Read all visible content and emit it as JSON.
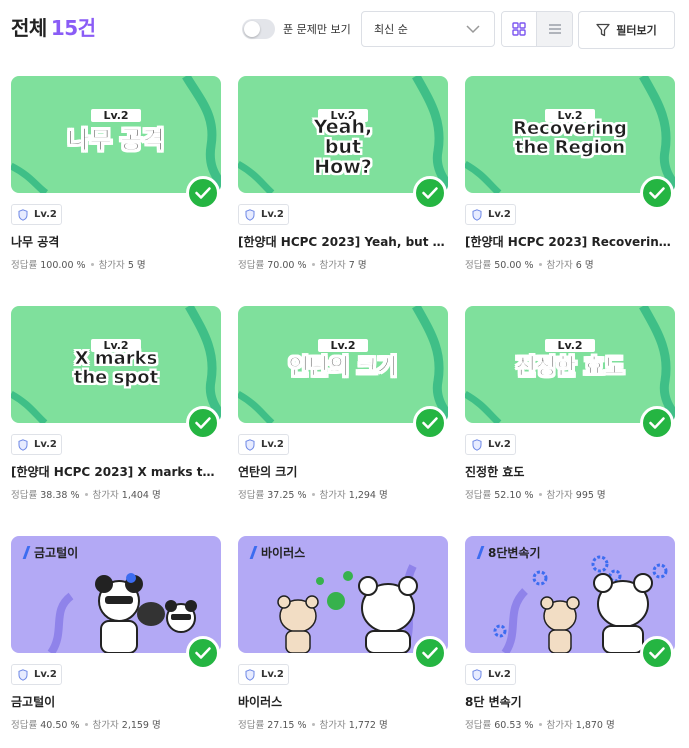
{
  "header": {
    "title": "전체",
    "count": "15건",
    "toggle_label": "푼 문제만 보기",
    "sort_value": "최신 순",
    "filter_label": "필터보기"
  },
  "stats_labels": {
    "rate": "정답률",
    "participants": "참가자"
  },
  "cards": [
    {
      "level": "Lv.2",
      "title": "나무 공격",
      "rate": "100.00 %",
      "participants": "5 명",
      "banner": "나무 공격",
      "banner_lv": "Lv.2"
    },
    {
      "level": "Lv.2",
      "title": "[한양대 HCPC 2023] Yeah, but H...",
      "rate": "70.00 %",
      "participants": "7 명",
      "banner": "Yeah, but How?",
      "banner_lv": "Lv.2"
    },
    {
      "level": "Lv.2",
      "title": "[한양대 HCPC 2023] Recovering ...",
      "rate": "50.00 %",
      "participants": "6 명",
      "banner": "Recovering the Region",
      "banner_lv": "Lv.2"
    },
    {
      "level": "Lv.2",
      "title": "[한양대 HCPC 2023] X marks the...",
      "rate": "38.38 %",
      "participants": "1,404 명",
      "banner": "X marks the spot",
      "banner_lv": "Lv.2"
    },
    {
      "level": "Lv.2",
      "title": "연탄의 크기",
      "rate": "37.25 %",
      "participants": "1,294 명",
      "banner": "연탄의 크기",
      "banner_lv": "Lv.2"
    },
    {
      "level": "Lv.2",
      "title": "진정한 효도",
      "rate": "52.10 %",
      "participants": "995 명",
      "banner": "진정한 효도",
      "banner_lv": "Lv.2"
    },
    {
      "level": "Lv.2",
      "title": "금고털이",
      "rate": "40.50 %",
      "participants": "2,159 명",
      "banner": "금고털이"
    },
    {
      "level": "Lv.2",
      "title": "바이러스",
      "rate": "27.15 %",
      "participants": "1,772 명",
      "banner": "바이러스"
    },
    {
      "level": "Lv.2",
      "title": "8단 변속기",
      "rate": "60.53 %",
      "participants": "1,870 명",
      "banner": "8단변속기"
    }
  ],
  "colors": {
    "accent": "#8a5cf6",
    "thumb_green": "#7fe09c",
    "thumb_purple": "#b3a9f5",
    "check_green": "#25b542"
  },
  "icons": {
    "solved": "check-icon",
    "level": "shield-icon",
    "filter": "funnel-icon",
    "grid_view": "grid-icon",
    "list_view": "list-icon",
    "sort": "chevron-down-icon"
  }
}
